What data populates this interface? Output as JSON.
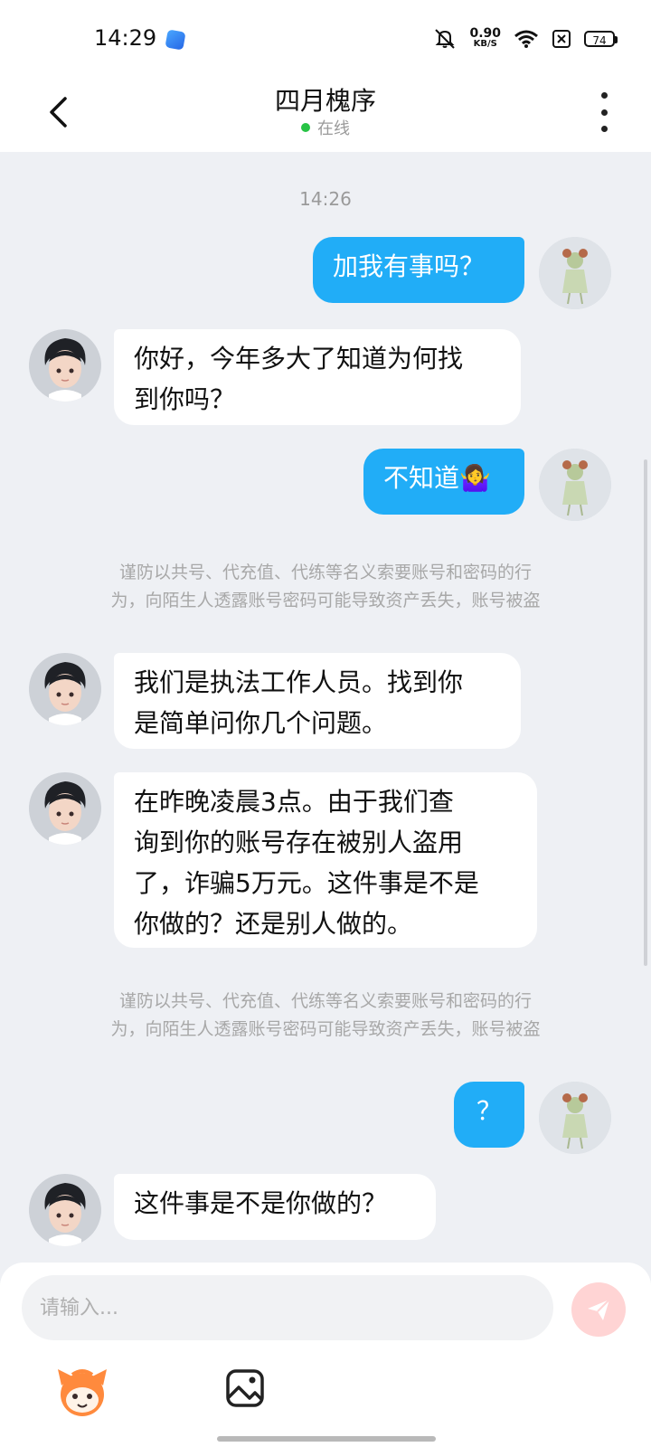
{
  "status_bar": {
    "time": "14:29",
    "net_speed_value": "0.90",
    "net_speed_unit": "KB/S",
    "battery": "74",
    "icons": [
      "app-icon",
      "mute-icon",
      "wifi-icon",
      "no-sim-icon",
      "battery-icon"
    ]
  },
  "header": {
    "title": "四月槐序",
    "status": "在线",
    "back_icon": "chevron-left-icon",
    "more_icon": "more-vertical-icon"
  },
  "chat": {
    "timestamp": "14:26",
    "messages": [
      {
        "from": "me",
        "text": "加我有事吗？"
      },
      {
        "from": "them",
        "lines": [
          "你好，今年多大了知道为何找",
          "到你吗？"
        ]
      },
      {
        "from": "me",
        "text": "不知道🤷‍♀️"
      },
      {
        "from": "them",
        "lines": [
          "我们是执法工作人员。找到你",
          "是简单问你几个问题。"
        ]
      },
      {
        "from": "them",
        "lines": [
          "在昨晚凌晨3点。由于我们查",
          "询到你的账号存在被别人盗用",
          "了，诈骗5万元。这件事是不是",
          "你做的？还是别人做的。"
        ]
      },
      {
        "from": "me",
        "text": "？"
      },
      {
        "from": "them",
        "text": "这件事是不是你做的？"
      }
    ],
    "notice_lines": [
      "谨防以共号、代充值、代练等名义索要账号和密码的行",
      "为，向陌生人透露账号密码可能导致资产丢失，账号被盗"
    ]
  },
  "input": {
    "placeholder": "请输入...",
    "value": "",
    "send_icon": "send-icon",
    "emoji_icon": "emoji-mascot-icon",
    "image_icon": "image-icon"
  },
  "colors": {
    "me_bubble": "#21adf7",
    "them_bubble": "#ffffff",
    "background": "#eef0f4",
    "online": "#27c345",
    "send_button": "#ffd4d4"
  }
}
